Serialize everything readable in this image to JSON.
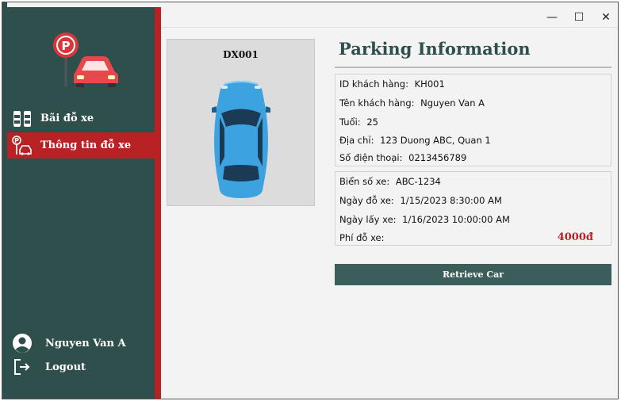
{
  "window": {
    "controls": {
      "minimize": "—",
      "maximize": "☐",
      "close": "✕"
    }
  },
  "sidebar": {
    "logo": "parking-logo",
    "items": [
      {
        "label": "Bãi đỗ xe",
        "icon": "parking-lot-icon",
        "active": false
      },
      {
        "label": "Thông tin đỗ xe",
        "icon": "parking-info-icon",
        "active": true
      }
    ],
    "user": {
      "name": "Nguyen Van A",
      "icon": "user-avatar-icon"
    },
    "logout": {
      "label": "Logout",
      "icon": "logout-icon"
    }
  },
  "car": {
    "id": "DX001",
    "image": "car-top-view",
    "color": "#3da3e0"
  },
  "page": {
    "title": "Parking Information"
  },
  "customer": {
    "id": {
      "label": "ID khách hàng:",
      "value": "KH001"
    },
    "name": {
      "label": "Tên khách hàng:",
      "value": "Nguyen Van A"
    },
    "age": {
      "label": "Tuổi:",
      "value": "25"
    },
    "address": {
      "label": "Địa chỉ:",
      "value": "123 Duong ABC, Quan 1"
    },
    "phone": {
      "label": "Số điện thoại:",
      "value": "0213456789"
    }
  },
  "parking": {
    "plate": {
      "label": "Biển số xe:",
      "value": "ABC-1234"
    },
    "park_date": {
      "label": "Ngày đỗ xe:",
      "value": "1/15/2023 8:30:00 AM"
    },
    "pickup_date": {
      "label": "Ngày lấy xe:",
      "value": "1/16/2023 10:00:00 AM"
    },
    "fee": {
      "label": "Phí đỗ xe:",
      "value": "4000đ"
    }
  },
  "actions": {
    "retrieve_label": "Retrieve Car"
  },
  "colors": {
    "sidebar": "#2f4f4c",
    "accent": "#b82225",
    "button": "#3c5e5a"
  }
}
